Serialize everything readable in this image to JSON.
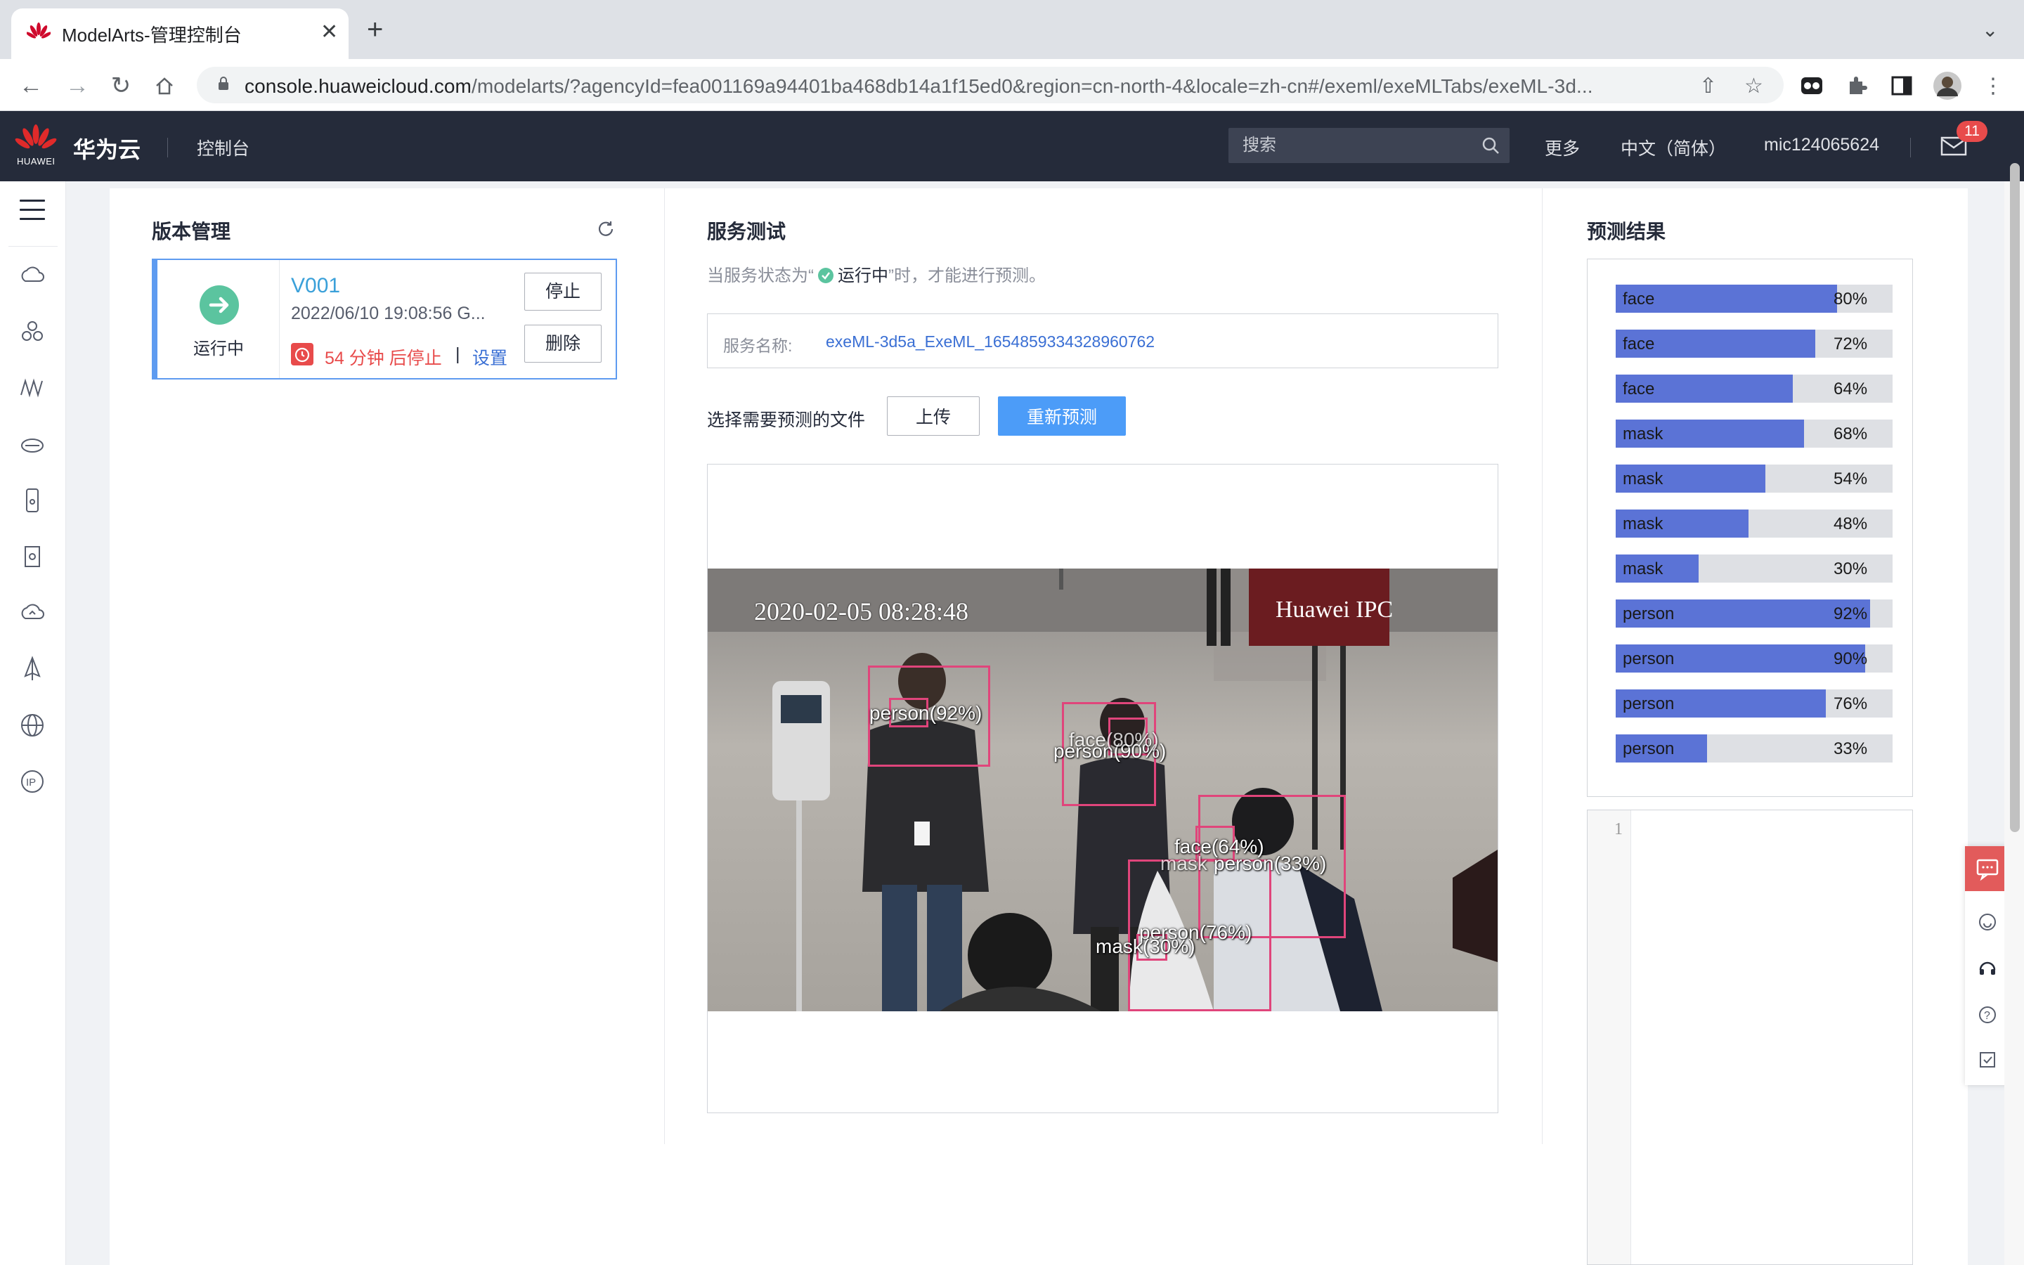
{
  "browser": {
    "tab_title": "ModelArts-管理控制台",
    "url_host": "console.huaweicloud.com",
    "url_path": "/modelarts/?agencyId=fea001169a94401ba468db14a1f15ed0&region=cn-north-4&locale=zh-cn#/exeml/exeMLTabs/exeML-3d..."
  },
  "header": {
    "brand": "华为云",
    "logo_text": "HUAWEI",
    "console": "控制台",
    "search_placeholder": "搜索",
    "more": "更多",
    "language": "中文（简体）",
    "username": "mic124065624",
    "mail_count": "11"
  },
  "version_panel": {
    "title": "版本管理",
    "status": "运行中",
    "version": "V001",
    "date": "2022/06/10 19:08:56 G...",
    "countdown": "54 分钟 后停止",
    "separator": "|",
    "settings": "设置",
    "stop": "停止",
    "delete": "删除"
  },
  "service_test": {
    "title": "服务测试",
    "hint_prefix": "当服务状态为“",
    "hint_status": "运行中",
    "hint_suffix": "”时，才能进行预测。",
    "service_name_label": "服务名称:",
    "service_name": "exeML-3d5a_ExeML_1654859334328960762",
    "file_label": "选择需要预测的文件",
    "upload": "上传",
    "repredict": "重新预测",
    "image": {
      "timestamp": "2020-02-05  08:28:48",
      "sign_text": "Huawei IPC",
      "detections": [
        {
          "label": "person(92%)"
        },
        {
          "label": "person(90%)"
        },
        {
          "label": "face(80%)"
        },
        {
          "label": "face(64%)"
        },
        {
          "label": "mask"
        },
        {
          "label": "person(33%)"
        },
        {
          "label": "person(76%)"
        },
        {
          "label": "mask(30%)"
        }
      ]
    }
  },
  "predictions": {
    "title": "预测结果",
    "items": [
      {
        "label": "face",
        "value": "80%",
        "score": 0.8
      },
      {
        "label": "face",
        "value": "72%",
        "score": 0.72
      },
      {
        "label": "face",
        "value": "64%",
        "score": 0.64
      },
      {
        "label": "mask",
        "value": "68%",
        "score": 0.68
      },
      {
        "label": "mask",
        "value": "54%",
        "score": 0.54
      },
      {
        "label": "mask",
        "value": "48%",
        "score": 0.48
      },
      {
        "label": "mask",
        "value": "30%",
        "score": 0.3
      },
      {
        "label": "person",
        "value": "92%",
        "score": 0.92
      },
      {
        "label": "person",
        "value": "90%",
        "score": 0.9
      },
      {
        "label": "person",
        "value": "76%",
        "score": 0.76
      },
      {
        "label": "person",
        "value": "33%",
        "score": 0.33
      }
    ],
    "code_line_number": "1"
  },
  "colors": {
    "header_bg": "#252b3a",
    "primary_blue": "#4c9cf8",
    "bar_fill": "#5b73d6",
    "status_green": "#5bc49f",
    "alert_red": "#e84b4b",
    "bbox_pink": "#e0457b"
  }
}
